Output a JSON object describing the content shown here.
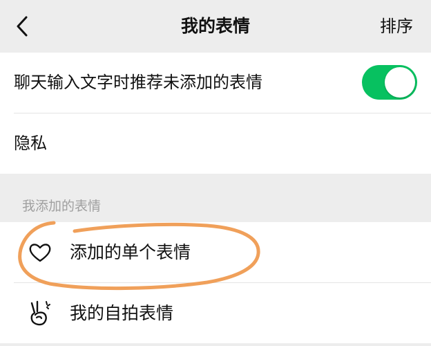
{
  "navbar": {
    "back_icon": "chevron-left-icon",
    "title": "我的表情",
    "sort_label": "排序"
  },
  "settings": {
    "recommend_label": "聊天输入文字时推荐未添加的表情",
    "recommend_enabled": true,
    "privacy_label": "隐私"
  },
  "section": {
    "header": "我添加的表情",
    "items": [
      {
        "label": "添加的单个表情",
        "icon": "heart-icon"
      },
      {
        "label": "我的自拍表情",
        "icon": "victory-hand-icon"
      }
    ]
  },
  "annotation": {
    "circled_item": "添加的单个表情",
    "color": "#f0a05a"
  },
  "colors": {
    "toggle_on": "#07c160",
    "background": "#ededed"
  }
}
